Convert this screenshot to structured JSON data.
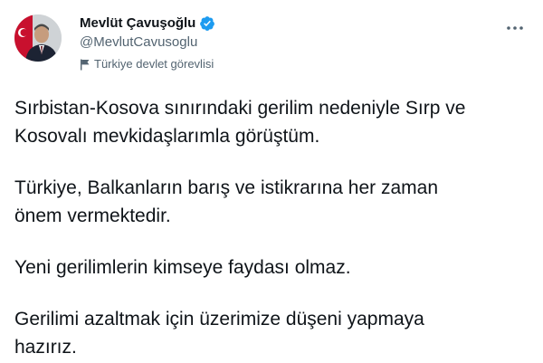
{
  "author": {
    "display_name": "Mevlüt Çavuşoğlu",
    "handle": "@MevlutCavusoglu",
    "affiliation_label": "Türkiye devlet görevlisi"
  },
  "icons": {
    "verified": "verified-badge-icon",
    "flag": "government-flag-icon",
    "more": "more-horizontal-icon"
  },
  "colors": {
    "verified_blue": "#1d9bf0",
    "secondary_text": "#536471",
    "primary_text": "#0f1419"
  },
  "tweet": {
    "paragraphs": [
      "Sırbistan-Kosova sınırındaki gerilim nedeniyle Sırp ve\nKosovalı mevkidaşlarımla görüştüm.",
      "Türkiye, Balkanların barış ve istikrarına her zaman\nönem vermektedir.",
      "Yeni gerilimlerin kimseye faydası olmaz.",
      "Gerilimi azaltmak için üzerimize düşeni yapmaya\nhazırız."
    ]
  }
}
